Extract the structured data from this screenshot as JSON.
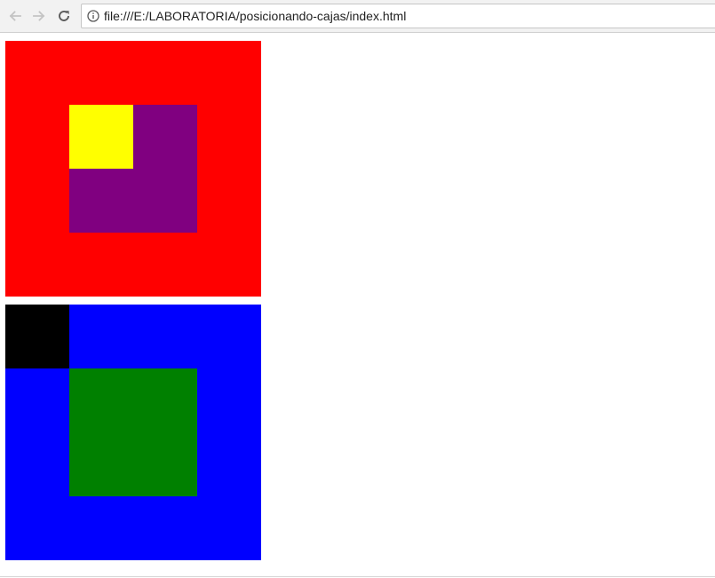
{
  "browser": {
    "url": "file:///E:/LABORATORIA/posicionando-cajas/index.html",
    "icons": {
      "back": "arrow-left-icon",
      "forward": "arrow-right-icon",
      "reload": "reload-icon",
      "info": "info-icon"
    },
    "colors": {
      "disabled_icon": "#c4c4c4",
      "active_icon": "#5a5a5a"
    }
  },
  "page": {
    "boxes": [
      {
        "name": "red-box",
        "color": "#ff0000"
      },
      {
        "name": "purple-box",
        "color": "#800080"
      },
      {
        "name": "yellow-box",
        "color": "#ffff00"
      },
      {
        "name": "blue-box",
        "color": "#0000ff"
      },
      {
        "name": "black-box",
        "color": "#000000"
      },
      {
        "name": "green-box",
        "color": "#008000"
      }
    ]
  }
}
